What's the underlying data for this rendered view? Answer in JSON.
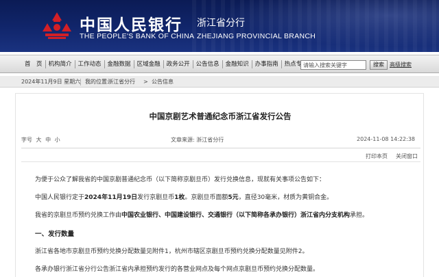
{
  "header": {
    "bank_name_cn": "中国人民银行",
    "branch_name_cn": "浙江省分行",
    "bank_name_en": "THE PEOPLE'S BANK OF CHINA",
    "branch_name_en": "ZHEJIANG PROVINCIAL BRANCH",
    "logo_icon": "pboc-emblem-icon",
    "colors": {
      "banner": "#11266c",
      "emblem": "#d21f26"
    }
  },
  "nav": {
    "items": [
      "首　页",
      "机构简介",
      "工作动态",
      "金融数据",
      "区域金融",
      "政务公开",
      "公告信息",
      "金融知识",
      "办事指南",
      "热点专题"
    ],
    "search_placeholder": "请输入搜索关键字",
    "search_button": "搜索",
    "advanced_search": "高级搜索"
  },
  "breadcrumb": {
    "date": "2024年11月9日 星期六",
    "location_label": "我的位置:",
    "location": "浙江省分行",
    "section": "公告信息"
  },
  "article": {
    "title": "中国京剧艺术普通纪念币浙江省发行公告",
    "font_size_label": "字号",
    "font_sizes": [
      "大",
      "中",
      "小"
    ],
    "source_label": "文章来源:",
    "source": "浙江省分行",
    "datetime": "2024-11-08 14:22:38",
    "print_label": "打印本页",
    "close_label": "关闭窗口",
    "p1": "为便于公众了解我省的中国京剧普通纪念币（以下简称京剧旦币）发行兑换信息，现就有关事项公告如下：",
    "p2_a": "中国人民银行定于",
    "p2_b": "2024年11月19日",
    "p2_c": "发行京剧旦币",
    "p2_d": "1枚",
    "p2_e": "。京剧旦币面额",
    "p2_f": "5元",
    "p2_g": "，直径30毫米，材质为黄铜合金。",
    "p3_a": "我省的京剧旦币预约兑换工作由",
    "p3_b": "中国农业银行、中国建设银行、交通银行（以下简称各承办银行）浙江省内分支机构",
    "p3_c": "承担。",
    "section1": "一、发行数量",
    "p4": "浙江省各地市京剧旦币预约兑换分配数量见附件1，杭州市辖区京剧旦币预约兑换分配数量见附件2。",
    "p5": "各承办银行浙江省分行公告浙江省内承担预约发行的各营业网点及每个网点京剧旦币预约兑换分配数量。"
  }
}
